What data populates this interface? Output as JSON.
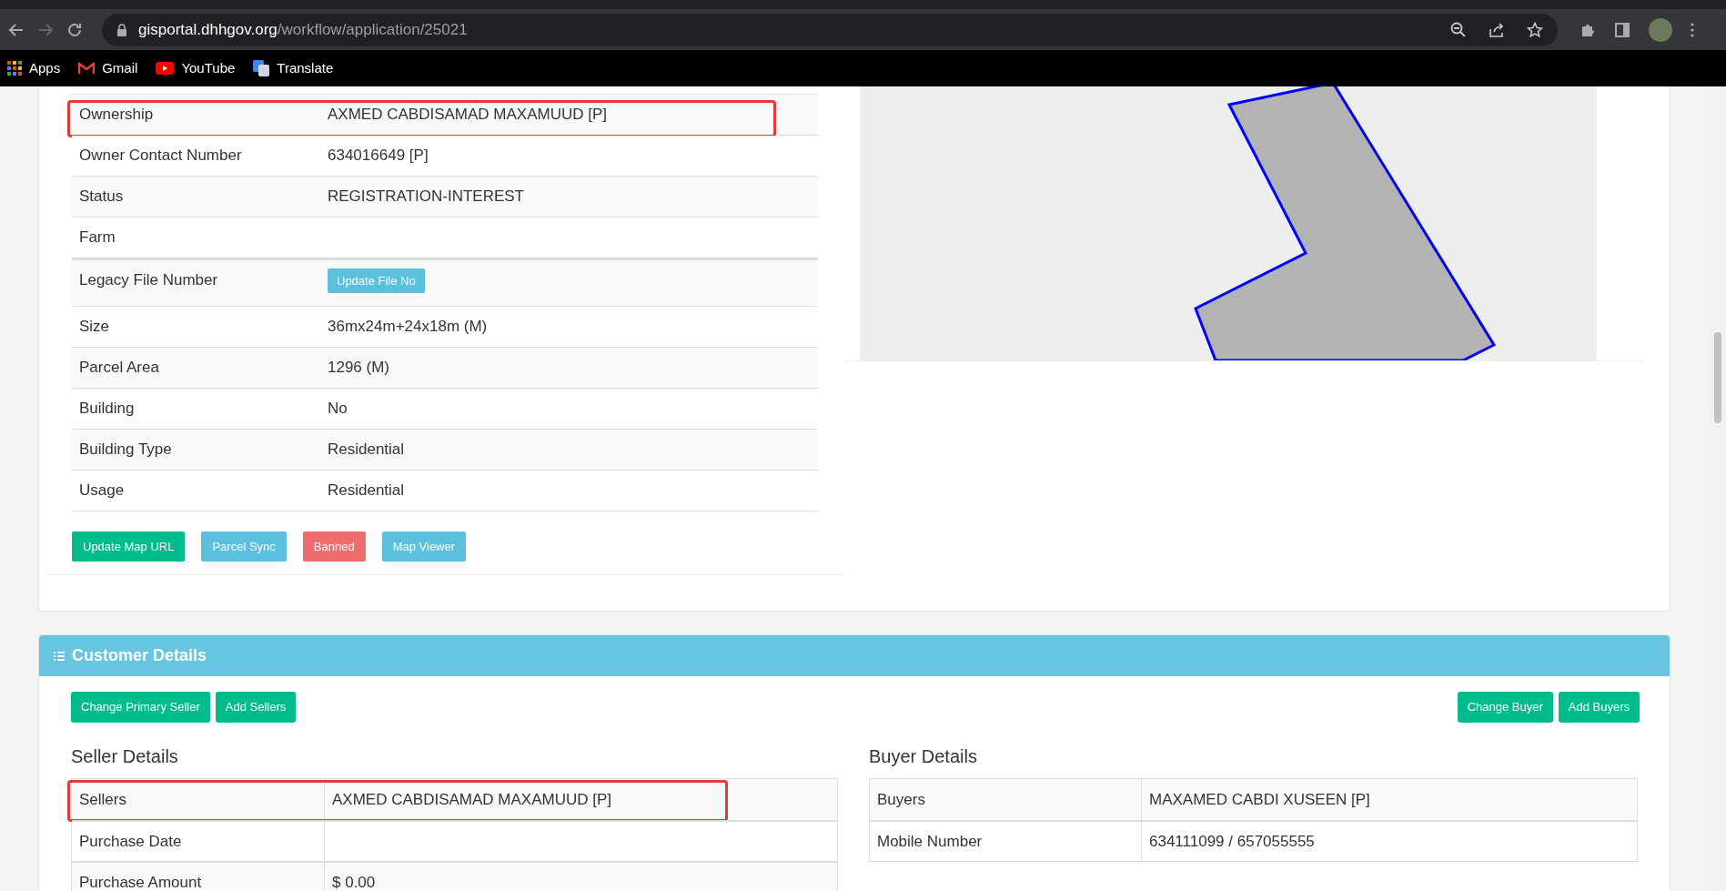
{
  "browser": {
    "url_domain": "gisportal.dhhgov.org",
    "url_path": "/workflow/application/25021",
    "bookmarks": [
      {
        "label": "Apps",
        "kind": "apps"
      },
      {
        "label": "Gmail",
        "kind": "gmail"
      },
      {
        "label": "YouTube",
        "kind": "youtube"
      },
      {
        "label": "Translate",
        "kind": "translate"
      }
    ]
  },
  "property_details": {
    "rows": [
      {
        "label": "Ownership",
        "value": "AXMED CABDISAMAD MAXAMUUD [P]",
        "highlighted": true
      },
      {
        "label": "Owner Contact Number",
        "value": "634016649 [P]",
        "highlighted": false
      },
      {
        "label": "Status",
        "value": "REGISTRATION-INTEREST",
        "highlighted": false
      },
      {
        "label": "Farm",
        "highlighted": false
      },
      {
        "label": "Legacy File Number",
        "button": "Update File No",
        "highlighted": false
      },
      {
        "label": "Size",
        "value": "36mx24m+24x18m (M)",
        "highlighted": false
      },
      {
        "label": "Parcel Area",
        "value": "1296 (M)",
        "highlighted": false
      },
      {
        "label": "Building",
        "value": "No",
        "highlighted": false
      },
      {
        "label": "Building Type",
        "value": "Residential",
        "highlighted": false
      },
      {
        "label": "Usage",
        "value": "Residential",
        "highlighted": false
      }
    ],
    "actions": [
      {
        "label": "Update Map URL",
        "kind": "success"
      },
      {
        "label": "Parcel Sync",
        "kind": "info"
      },
      {
        "label": "Banned",
        "kind": "danger"
      },
      {
        "label": "Map Viewer",
        "kind": "info"
      }
    ]
  },
  "customer_details": {
    "title": "Customer Details",
    "seller_actions": [
      {
        "label": "Change Primary Seller"
      },
      {
        "label": "Add Sellers"
      }
    ],
    "buyer_actions": [
      {
        "label": "Change Buyer"
      },
      {
        "label": "Add Buyers"
      }
    ],
    "seller": {
      "heading": "Seller Details",
      "rows": [
        {
          "label": "Sellers",
          "value": "AXMED CABDISAMAD MAXAMUUD [P]",
          "highlighted": true
        },
        {
          "label": "Purchase Date",
          "highlighted": false
        },
        {
          "label": "Purchase Amount",
          "value": "$ 0.00",
          "highlighted": false
        }
      ]
    },
    "buyer": {
      "heading": "Buyer Details",
      "rows": [
        {
          "label": "Buyers",
          "value": "MAXAMED CABDI XUSEEN [P]",
          "highlighted": false
        },
        {
          "label": "Mobile Number",
          "value": "634111099 / 657055555",
          "highlighted": false
        }
      ]
    }
  }
}
